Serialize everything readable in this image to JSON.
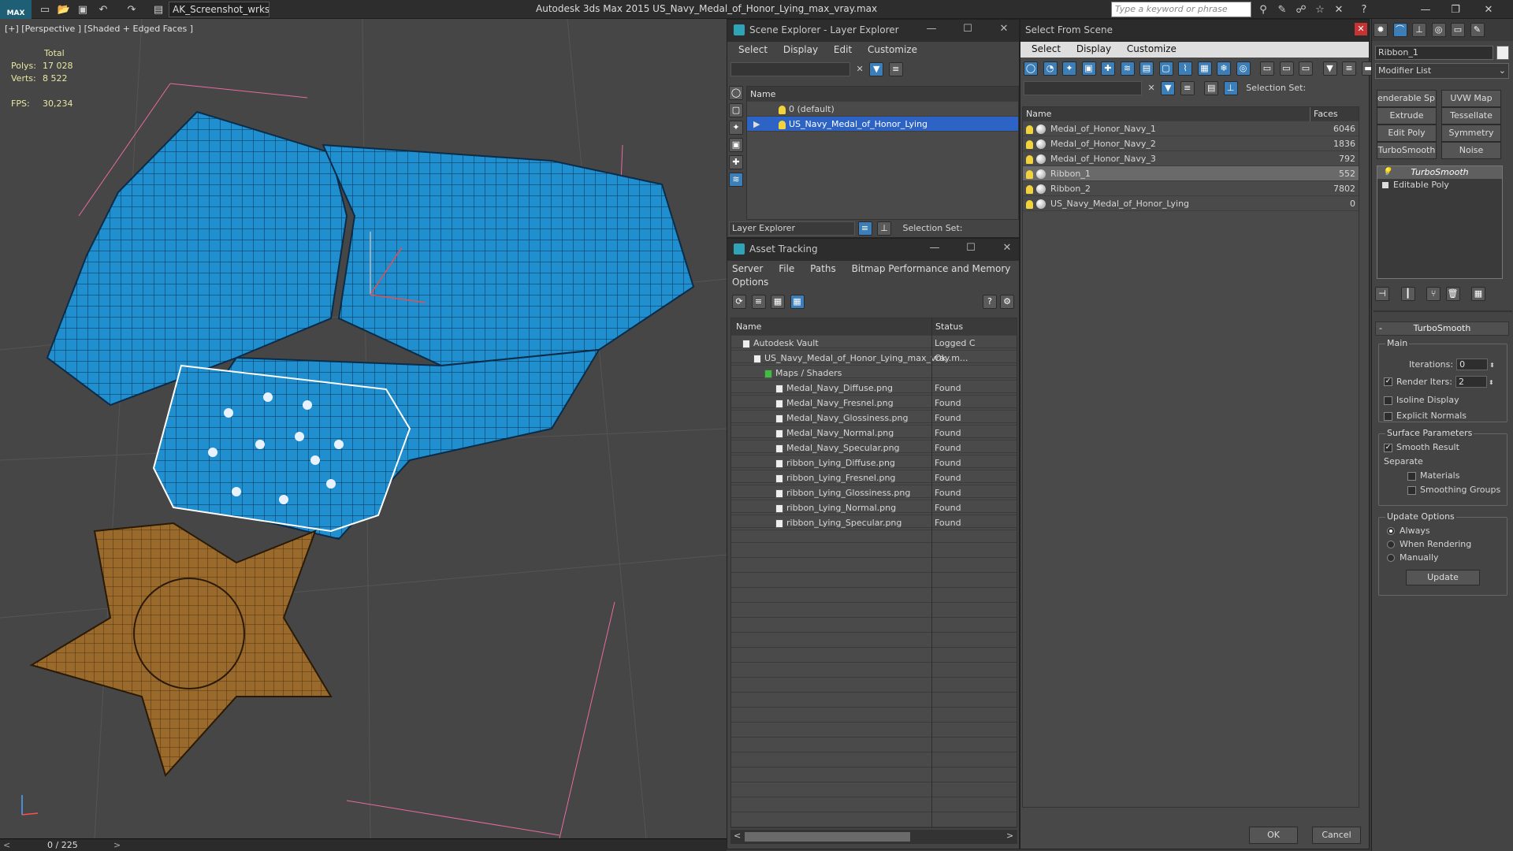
{
  "app": {
    "logo": "MAX",
    "workspace": "AK_Screenshot_wrksp",
    "title": "Autodesk 3ds Max  2015    US_Navy_Medal_of_Honor_Lying_max_vray.max",
    "search_placeholder": "Type a keyword or phrase"
  },
  "viewport": {
    "label": "[+] [Perspective ] [Shaded + Edged Faces ]",
    "stats": {
      "total": "Total",
      "polys_label": "Polys:",
      "polys": "17 028",
      "verts_label": "Verts:",
      "verts": "8 522",
      "fps_label": "FPS:",
      "fps": "30,234"
    },
    "timebar": "0 / 225"
  },
  "scene_explorer": {
    "title": "Scene Explorer - Layer Explorer",
    "menu": [
      "Select",
      "Display",
      "Edit",
      "Customize"
    ],
    "column": "Name",
    "layers": [
      {
        "name": "0 (default)",
        "selected": false
      },
      {
        "name": "US_Navy_Medal_of_Honor_Lying",
        "selected": true
      }
    ],
    "footer_dropdown": "Layer Explorer",
    "selection_set": "Selection Set:"
  },
  "asset_tracking": {
    "title": "Asset Tracking",
    "menu": [
      "Server",
      "File",
      "Paths",
      "Bitmap Performance and Memory"
    ],
    "menu2": "Options",
    "columns": {
      "name": "Name",
      "status": "Status"
    },
    "rows": [
      {
        "name": "Autodesk Vault",
        "status": "Logged C",
        "indent": 0
      },
      {
        "name": "US_Navy_Medal_of_Honor_Lying_max_vray.m...",
        "status": "Ok",
        "indent": 1
      },
      {
        "name": "Maps / Shaders",
        "status": "",
        "indent": 2
      },
      {
        "name": "Medal_Navy_Diffuse.png",
        "status": "Found",
        "indent": 3
      },
      {
        "name": "Medal_Navy_Fresnel.png",
        "status": "Found",
        "indent": 3
      },
      {
        "name": "Medal_Navy_Glossiness.png",
        "status": "Found",
        "indent": 3
      },
      {
        "name": "Medal_Navy_Normal.png",
        "status": "Found",
        "indent": 3
      },
      {
        "name": "Medal_Navy_Specular.png",
        "status": "Found",
        "indent": 3
      },
      {
        "name": "ribbon_Lying_Diffuse.png",
        "status": "Found",
        "indent": 3
      },
      {
        "name": "ribbon_Lying_Fresnel.png",
        "status": "Found",
        "indent": 3
      },
      {
        "name": "ribbon_Lying_Glossiness.png",
        "status": "Found",
        "indent": 3
      },
      {
        "name": "ribbon_Lying_Normal.png",
        "status": "Found",
        "indent": 3
      },
      {
        "name": "ribbon_Lying_Specular.png",
        "status": "Found",
        "indent": 3
      }
    ]
  },
  "select_from_scene": {
    "title": "Select From Scene",
    "menu": [
      "Select",
      "Display",
      "Customize"
    ],
    "selection_set": "Selection Set:",
    "columns": {
      "name": "Name",
      "faces": "Faces"
    },
    "rows": [
      {
        "name": "Medal_of_Honor_Navy_1",
        "faces": "6046",
        "selected": false
      },
      {
        "name": "Medal_of_Honor_Navy_2",
        "faces": "1836",
        "selected": false
      },
      {
        "name": "Medal_of_Honor_Navy_3",
        "faces": "792",
        "selected": false
      },
      {
        "name": "Ribbon_1",
        "faces": "552",
        "selected": true
      },
      {
        "name": "Ribbon_2",
        "faces": "7802",
        "selected": false
      },
      {
        "name": "US_Navy_Medal_of_Honor_Lying",
        "faces": "0",
        "selected": false
      }
    ],
    "ok": "OK",
    "cancel": "Cancel"
  },
  "modify_panel": {
    "object_name": "Ribbon_1",
    "modifier_list": "Modifier List",
    "buttons": [
      "enderable Splir",
      "UVW Map",
      "Extrude",
      "Tessellate",
      "Edit Poly",
      "Symmetry",
      "TurboSmooth",
      "Noise"
    ],
    "stack": [
      "TurboSmooth",
      "Editable Poly"
    ],
    "rollout_title": "TurboSmooth",
    "main": "Main",
    "iterations_label": "Iterations:",
    "iterations": "0",
    "render_iters_label": "Render Iters:",
    "render_iters": "2",
    "isoline": "Isoline Display",
    "explicit_normals": "Explicit Normals",
    "surface_params": "Surface Parameters",
    "smooth_result": "Smooth Result",
    "separate": "Separate",
    "materials": "Materials",
    "smoothing_groups": "Smoothing Groups",
    "update_options": "Update Options",
    "always": "Always",
    "when_rendering": "When Rendering",
    "manually": "Manually",
    "update": "Update"
  }
}
